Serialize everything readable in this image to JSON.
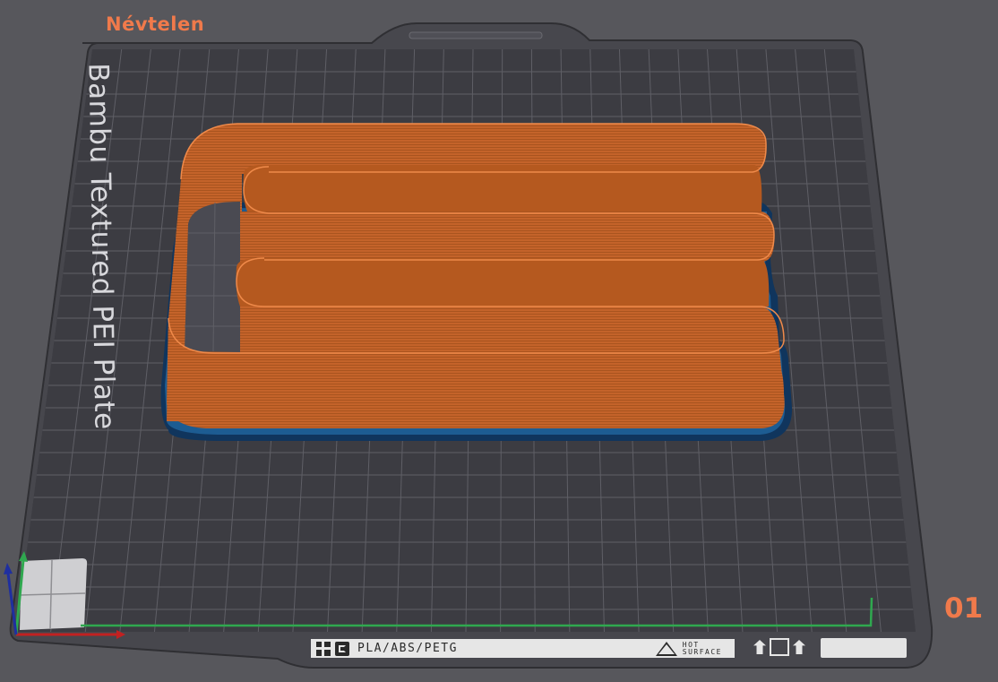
{
  "plate": {
    "name": "Névtelen",
    "number": "01",
    "brand_text": "Bambu Textured PEI Plate",
    "label_strip": {
      "filament_types": "PLA/ABS/PETG",
      "warning_line1": "HOT",
      "warning_line2": "SURFACE"
    }
  },
  "model": {
    "shape": "serpentine-wall",
    "wall_color": "#c8662a",
    "wall_highlight": "#ef8a4a",
    "brim_color": "#124a7a"
  },
  "icons": {
    "plate_handle": "handle-notch",
    "axis": "xyz-axes-icon",
    "logo": "bambu-logo-icon",
    "corner_marker": "origin-corner-icon",
    "warning": "warning-triangle-icon"
  },
  "colors": {
    "background": "#57575c",
    "plate": "#3c3c41",
    "accent": "#f07a4b",
    "x_axis": "#c22121",
    "y_axis": "#2fa84f",
    "z_axis": "#1f2fa0"
  }
}
